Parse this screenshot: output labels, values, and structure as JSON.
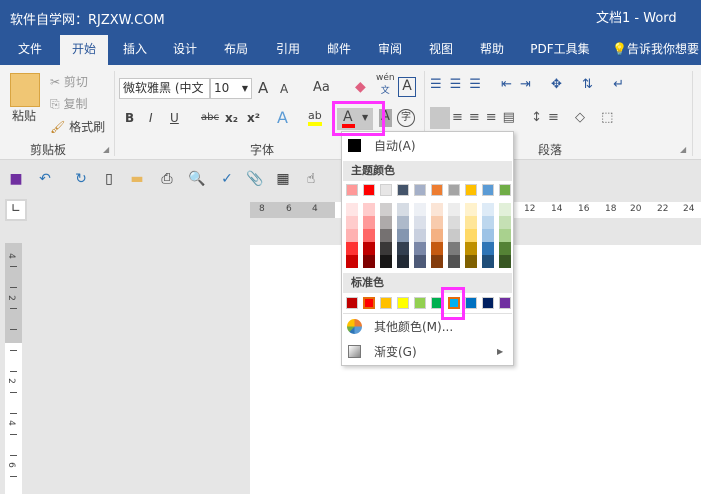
{
  "title": {
    "site": "软件自学网：RJZXW.COM",
    "doc": "文档1  -  Word"
  },
  "tabs": [
    "文件",
    "开始",
    "插入",
    "设计",
    "布局",
    "引用",
    "邮件",
    "审阅",
    "视图",
    "帮助",
    "PDF工具集",
    "告诉我你想要"
  ],
  "ribbon": {
    "clipboard": {
      "paste": "粘贴",
      "cut": "剪切",
      "copy": "复制",
      "format_painter": "格式刷",
      "label": "剪贴板"
    },
    "font": {
      "name": "微软雅黑 (中文",
      "size": "10",
      "label": "字体",
      "grow": "A",
      "shrink": "A",
      "case": "Aa",
      "bold": "B",
      "italic": "I",
      "underline": "U",
      "strike": "abc",
      "sub": "x₂",
      "sup": "x²",
      "phonetic_top": "wén",
      "phonetic_bottom": "文",
      "border_char": "A",
      "effect": "A",
      "font_color": "A",
      "shading": "A",
      "enclose": "字"
    },
    "paragraph": {
      "label": "段落"
    }
  },
  "ruler": {
    "h": [
      "8",
      "6",
      "4",
      "12",
      "14",
      "16",
      "18",
      "20",
      "22",
      "24"
    ],
    "v": [
      "4",
      "2",
      "2",
      "4",
      "6"
    ]
  },
  "color_menu": {
    "auto": "自动(A)",
    "theme_header": "主题颜色",
    "standard_header": "标准色",
    "more": "其他颜色(M)...",
    "gradient": "渐变(G)",
    "theme_top": [
      "#ff9999",
      "#ff0000",
      "#e7e6e6",
      "#44546a",
      "#a5b0c8",
      "#ed7d31",
      "#a5a5a5",
      "#ffc000",
      "#5b9bd5",
      "#70ad47"
    ],
    "theme_shades": [
      [
        "#ffe5e5",
        "#ffcccc",
        "#ffb2b2",
        "#ff3333",
        "#cc0000"
      ],
      [
        "#ffcccc",
        "#ff9999",
        "#ff6666",
        "#bf0000",
        "#7f0000"
      ],
      [
        "#d0cece",
        "#aeaaaa",
        "#757171",
        "#3a3838",
        "#171616"
      ],
      [
        "#d6dce4",
        "#adb9ca",
        "#8496b0",
        "#333f50",
        "#222a35"
      ],
      [
        "#edf0f5",
        "#dbe0ea",
        "#c9d0df",
        "#7a87a8",
        "#4e5a78"
      ],
      [
        "#fbe5d6",
        "#f8cbad",
        "#f4b183",
        "#c55a11",
        "#843c0c"
      ],
      [
        "#ededed",
        "#dbdbdb",
        "#c9c9c9",
        "#7b7b7b",
        "#525252"
      ],
      [
        "#fff2cc",
        "#ffe699",
        "#ffd966",
        "#bf9000",
        "#7f6000"
      ],
      [
        "#deebf7",
        "#bdd7ee",
        "#9dc3e6",
        "#2e75b6",
        "#1f4e79"
      ],
      [
        "#e2f0d9",
        "#c5e0b4",
        "#a9d18e",
        "#548235",
        "#385723"
      ]
    ],
    "standard": [
      "#c00000",
      "#ff0000",
      "#ffc000",
      "#ffff00",
      "#92d050",
      "#00b050",
      "#00b0f0",
      "#0070c0",
      "#002060",
      "#7030a0"
    ],
    "selected_standard": "#00b0f0",
    "current_font_color": "#ff0000"
  },
  "colors": {
    "brand": "#2b579a",
    "highlight": "#ff33ff"
  }
}
